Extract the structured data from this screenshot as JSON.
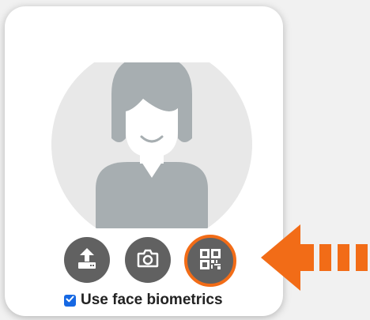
{
  "profile": {
    "avatar_icon": "default-user-avatar-icon",
    "actions": [
      {
        "name": "upload",
        "icon": "upload-icon"
      },
      {
        "name": "camera",
        "icon": "camera-icon"
      },
      {
        "name": "qr",
        "icon": "qr-code-icon",
        "highlighted": true
      }
    ],
    "biometrics": {
      "label": "Use face biometrics",
      "checked": true
    }
  },
  "annotation": {
    "icon": "pointer-arrow-icon",
    "color": "#f26c17"
  },
  "colors": {
    "button_bg": "#616161",
    "avatar_bg": "#e8e8e8",
    "avatar_figure": "#a7aeb1",
    "checkbox": "#1668e3"
  }
}
